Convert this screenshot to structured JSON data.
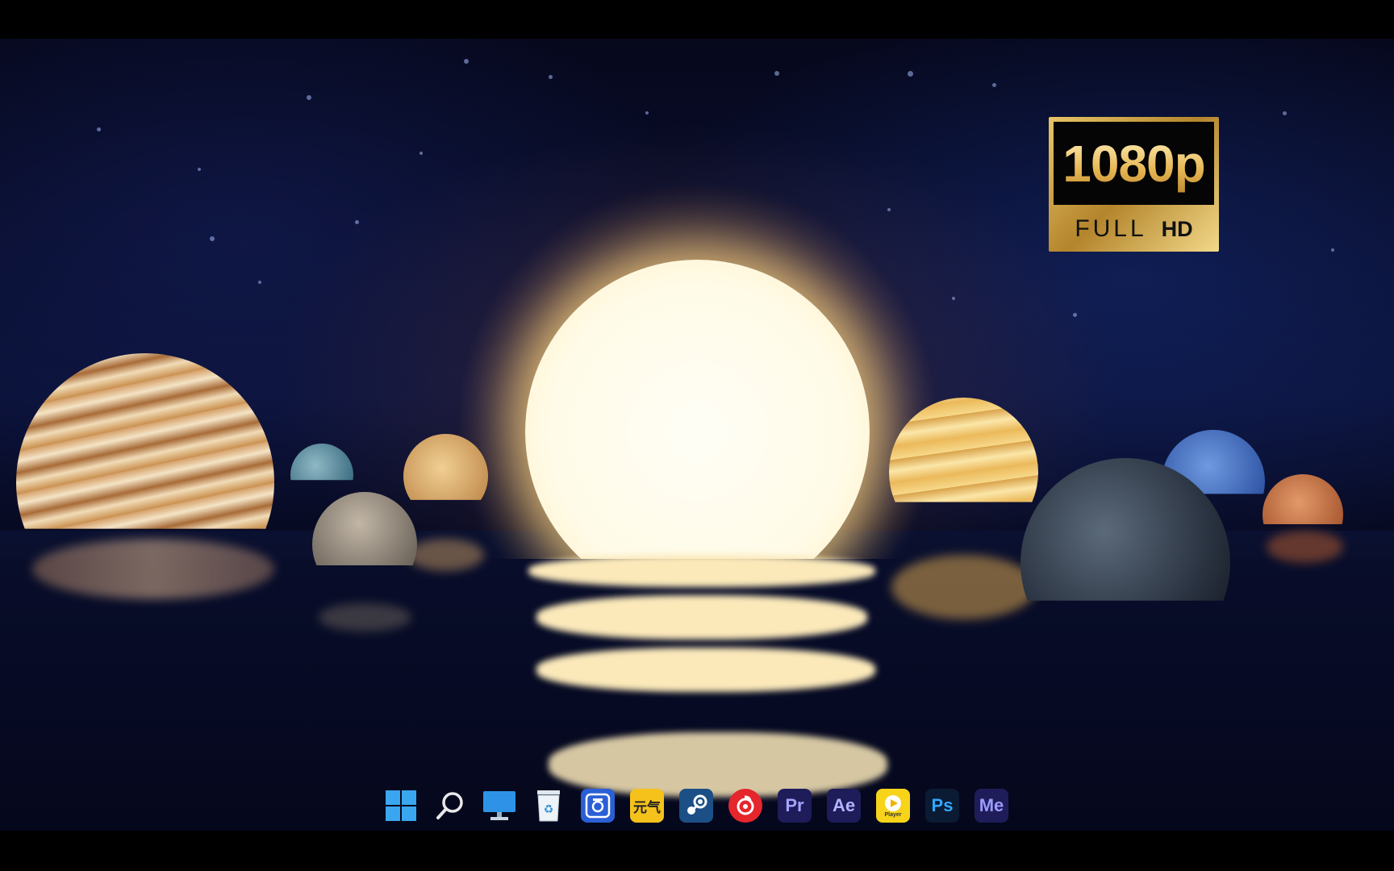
{
  "badge": {
    "resolution": "1080p",
    "label_full": "FULL",
    "label_hd": "HD"
  },
  "taskbar": {
    "items": [
      {
        "name": "Start",
        "icon": "windows-start-icon"
      },
      {
        "name": "Search",
        "icon": "search-icon"
      },
      {
        "name": "This PC",
        "icon": "monitor-icon"
      },
      {
        "name": "Recycle Bin",
        "icon": "recycle-bin-icon"
      },
      {
        "name": "Screenshot",
        "icon": "camera-capture-icon"
      },
      {
        "name": "Yuanqi",
        "icon": "yuanqi-app-icon",
        "text": "元气"
      },
      {
        "name": "Steam",
        "icon": "steam-icon"
      },
      {
        "name": "NetEase Music",
        "icon": "netease-music-icon"
      },
      {
        "name": "Premiere Pro",
        "icon": "premiere-pro-icon",
        "text": "Pr"
      },
      {
        "name": "After Effects",
        "icon": "after-effects-icon",
        "text": "Ae"
      },
      {
        "name": "Player",
        "icon": "media-player-icon",
        "text": "Player"
      },
      {
        "name": "Photoshop",
        "icon": "photoshop-icon",
        "text": "Ps"
      },
      {
        "name": "Media Encoder",
        "icon": "media-encoder-icon",
        "text": "Me"
      }
    ]
  },
  "colors": {
    "sun": "#fffbe8",
    "badge_gold": "#d4a64a",
    "adobe_bg": "#1f1c5a",
    "premiere_text": "#a3a3ff",
    "after_effects_text": "#b3b3ff",
    "photoshop_text": "#31a8ff",
    "media_encoder_text": "#9b9bff"
  }
}
